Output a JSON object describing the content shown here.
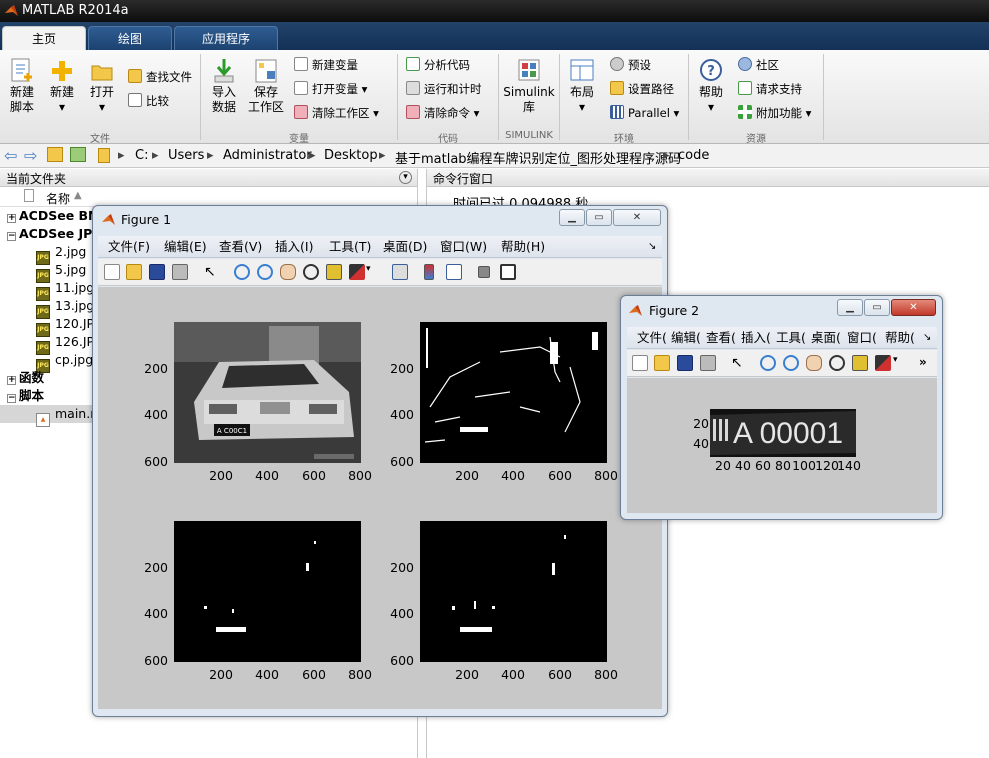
{
  "app": {
    "title": "MATLAB R2014a"
  },
  "tabs": [
    "主页",
    "绘图",
    "应用程序"
  ],
  "ribbon": {
    "file": {
      "group": "文件",
      "new_script": [
        "新建",
        "脚本"
      ],
      "new": "新建",
      "open": "打开",
      "find_files": "查找文件",
      "compare": "比较"
    },
    "variable": {
      "group": "变量",
      "import": [
        "导入",
        "数据"
      ],
      "save_ws": [
        "保存",
        "工作区"
      ],
      "new_var": "新建变量",
      "open_var": "打开变量",
      "clear_ws": "清除工作区"
    },
    "code": {
      "group": "代码",
      "analyze": "分析代码",
      "run_time": "运行和计时",
      "clear_cmd": "清除命令"
    },
    "simulink": {
      "group": "SIMULINK",
      "label": [
        "Simulink",
        "库"
      ]
    },
    "env": {
      "group": "环境",
      "layout": "布局",
      "prefs": "预设",
      "set_path": "设置路径",
      "parallel": "Parallel"
    },
    "resources": {
      "group": "资源",
      "help": "帮助",
      "community": "社区",
      "support": "请求支持",
      "addons": "附加功能"
    }
  },
  "address": {
    "parts": [
      "C:",
      "Users",
      "Administrator",
      "Desktop",
      "基于matlab编程车牌识别定位_图形处理程序源码",
      "code"
    ]
  },
  "current_folder": {
    "title": "当前文件夹",
    "column": "名称",
    "items": [
      {
        "label": "ACDSee BMP",
        "type": "folder",
        "state": "+"
      },
      {
        "label": "ACDSee JPEG",
        "type": "folder",
        "state": "−"
      },
      {
        "label": "2.jpg",
        "type": "jpg"
      },
      {
        "label": "5.jpg",
        "type": "jpg"
      },
      {
        "label": "11.jpg",
        "type": "jpg"
      },
      {
        "label": "13.jpg",
        "type": "jpg"
      },
      {
        "label": "120.JPG",
        "type": "jpg"
      },
      {
        "label": "126.JPG",
        "type": "jpg"
      },
      {
        "label": "cp.jpg",
        "type": "jpg"
      },
      {
        "label": "函数",
        "type": "folder",
        "state": "+"
      },
      {
        "label": "脚本",
        "type": "folder",
        "state": "−"
      },
      {
        "label": "main.m",
        "type": "m"
      }
    ]
  },
  "command_window": {
    "title": "命令行窗口",
    "text": "时间已过 0.094988 秒。"
  },
  "figure1": {
    "title": "Figure 1",
    "menu": [
      "文件(F)",
      "编辑(E)",
      "查看(V)",
      "插入(I)",
      "工具(T)",
      "桌面(D)",
      "窗口(W)",
      "帮助(H)"
    ],
    "yticks": [
      "200",
      "400",
      "600"
    ],
    "xticks": [
      "200",
      "400",
      "600",
      "800"
    ]
  },
  "figure2": {
    "title": "Figure 2",
    "menu": [
      "文件(",
      "编辑(",
      "查看(",
      "插入(",
      "工具(",
      "桌面(",
      "窗口(",
      "帮助("
    ],
    "yticks": [
      "20",
      "40"
    ],
    "xticks": [
      "20",
      "40",
      "60",
      "80",
      "100",
      "120",
      "140"
    ],
    "plate_text": "A 00001"
  }
}
